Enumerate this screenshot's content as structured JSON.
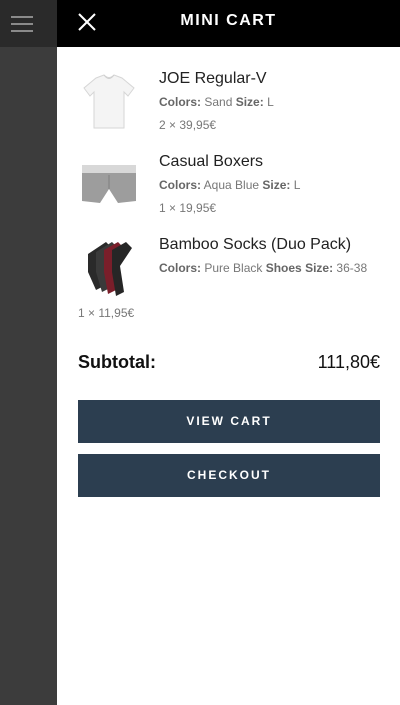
{
  "header": {
    "title": "MINI CART"
  },
  "items": [
    {
      "name": "JOE Regular-V",
      "colors_label": "Colors:",
      "color": "Sand",
      "size_label": "Size:",
      "size": "L",
      "qty_price": "2 × 39,95€",
      "icon": "white-tshirt-image"
    },
    {
      "name": "Casual Boxers",
      "colors_label": "Colors:",
      "color": "Aqua Blue",
      "size_label": "Size:",
      "size": "L",
      "qty_price": "1 × 19,95€",
      "icon": "grey-boxers-image"
    },
    {
      "name": "Bamboo Socks (Duo Pack)",
      "colors_label": "Colors:",
      "color": "Pure Black",
      "size_label": "Shoes Size:",
      "size": "36-38",
      "qty_price": "1 × 11,95€",
      "icon": "socks-image"
    }
  ],
  "subtotal": {
    "label": "Subtotal:",
    "value": "111,80€"
  },
  "buttons": {
    "view_cart": "VIEW CART",
    "checkout": "CHECKOUT"
  },
  "colors": {
    "header_bg": "#000000",
    "button_bg": "#2c3e50",
    "overlay": "#3c3c3c"
  }
}
